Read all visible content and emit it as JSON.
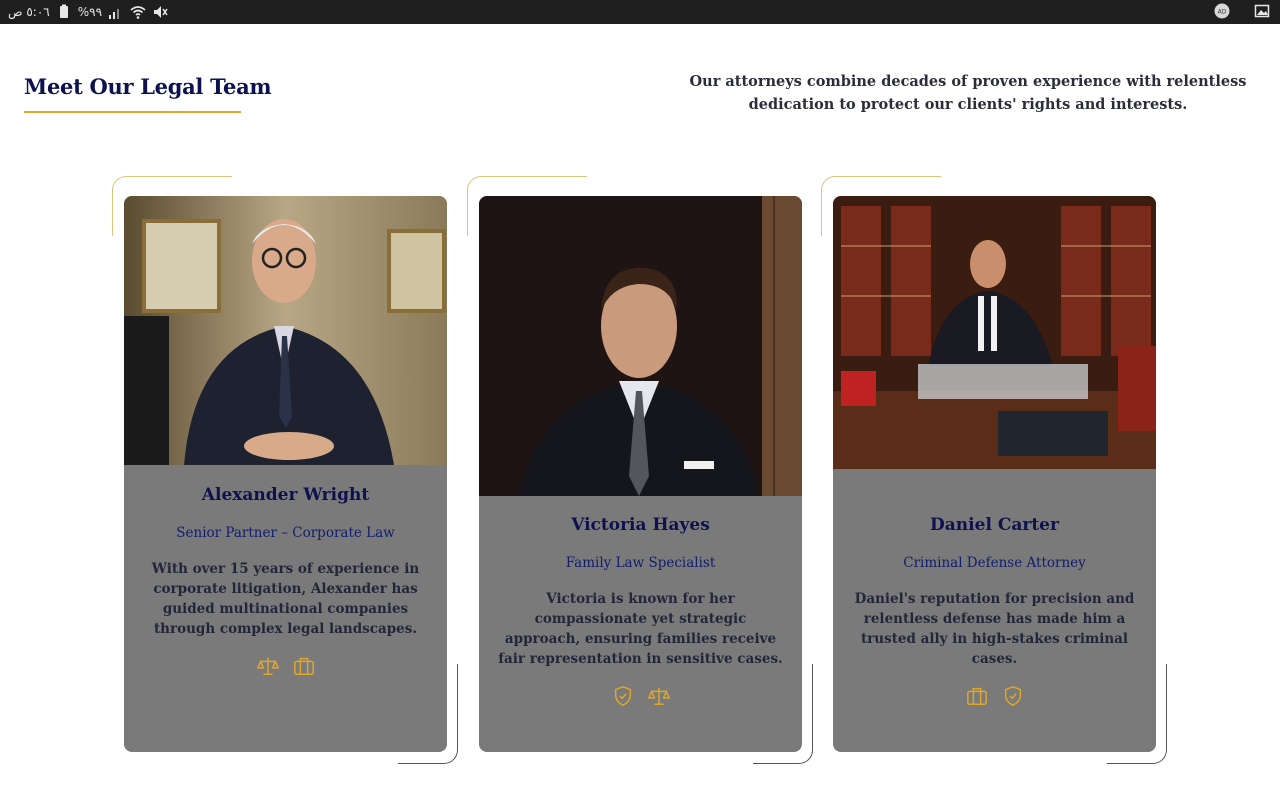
{
  "status_bar": {
    "time": "٥:٠٦ ص",
    "battery": "%٩٩",
    "left_icons": [
      "battery-icon",
      "signal-icon",
      "wifi-icon",
      "mute-icon"
    ],
    "right_icons": [
      "ad-icon",
      "gallery-icon"
    ],
    "ad_label": "AD"
  },
  "section": {
    "title": "Meet Our Legal Team",
    "description": "Our attorneys combine decades of proven experience with relentless dedication to protect our clients' rights and interests."
  },
  "colors": {
    "navy": "#0d1150",
    "gold": "#e0a72a",
    "card_bg": "#7a7a7a"
  },
  "team": [
    {
      "name": "Alexander Wright",
      "role": "Senior Partner – Corporate Law",
      "bio": "With over 15 years of experience in corporate litigation, Alexander has guided multinational companies through complex legal landscapes.",
      "icons": [
        "scales-icon",
        "briefcase-icon"
      ]
    },
    {
      "name": "Victoria Hayes",
      "role": "Family Law Specialist",
      "bio": "Victoria is known for her compassionate yet strategic approach, ensuring families receive fair representation in sensitive cases.",
      "icons": [
        "shield-check-icon",
        "scales-icon"
      ]
    },
    {
      "name": "Daniel Carter",
      "role": "Criminal Defense Attorney",
      "bio": "Daniel's reputation for precision and relentless defense has made him a trusted ally in high-stakes criminal cases.",
      "icons": [
        "briefcase-icon",
        "shield-check-icon"
      ]
    }
  ]
}
